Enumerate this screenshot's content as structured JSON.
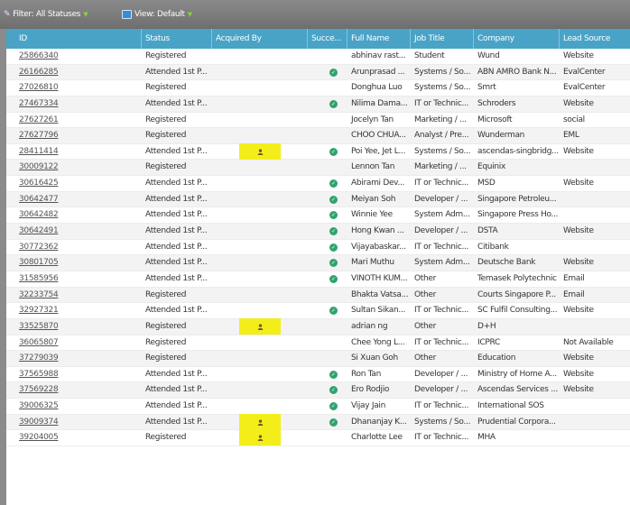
{
  "filterbar": {
    "filter_label": "Filter: All Statuses",
    "view_label": "View: Default",
    "filter_icon": "funnel-icon",
    "view_icon": "grid-view-icon",
    "caret_icon": "chevron-down-icon"
  },
  "colors": {
    "header": "#48a3c7",
    "success": "#2fa36f",
    "highlight": "#f3ee1a",
    "toolbar": "#7a7a7a"
  },
  "table": {
    "columns": [
      "ID",
      "Status",
      "Acquired By",
      "Succe...",
      "Full Name",
      "Job Title",
      "Company",
      "Lead Source"
    ],
    "rows": [
      {
        "id": "25866340",
        "status": "Registered",
        "acq": "",
        "success": false,
        "name": "abhinav rast...",
        "job": "Student",
        "company": "Wund",
        "source": "Website"
      },
      {
        "id": "26166285",
        "status": "Attended 1st P...",
        "acq": "",
        "success": true,
        "name": "Arunprasad ...",
        "job": "Systems / So...",
        "company": "ABN AMRO Bank N...",
        "source": "EvalCenter"
      },
      {
        "id": "27026810",
        "status": "Registered",
        "acq": "",
        "success": false,
        "name": "Donghua Luo",
        "job": "Systems / So...",
        "company": "Smrt",
        "source": "EvalCenter"
      },
      {
        "id": "27467334",
        "status": "Attended 1st P...",
        "acq": "",
        "success": true,
        "name": "Nilima Dama...",
        "job": "IT or Technic...",
        "company": "Schroders",
        "source": "Website"
      },
      {
        "id": "27627261",
        "status": "Registered",
        "acq": "",
        "success": false,
        "name": "Jocelyn Tan",
        "job": "Marketing / ...",
        "company": "Microsoft",
        "source": "social"
      },
      {
        "id": "27627796",
        "status": "Registered",
        "acq": "",
        "success": false,
        "name": "CHOO CHUA...",
        "job": "Analyst / Pre...",
        "company": "Wunderman",
        "source": "EML"
      },
      {
        "id": "28411414",
        "status": "Attended 1st P...",
        "acq": "person",
        "success": true,
        "name": "Poi Yee, Jet L...",
        "job": "Systems / So...",
        "company": "ascendas-singbridg...",
        "source": "Website"
      },
      {
        "id": "30009122",
        "status": "Registered",
        "acq": "",
        "success": false,
        "name": "Lennon Tan",
        "job": "Marketing / ...",
        "company": "Equinix",
        "source": ""
      },
      {
        "id": "30616425",
        "status": "Attended 1st P...",
        "acq": "",
        "success": true,
        "name": "Abirami Dev...",
        "job": "IT or Technic...",
        "company": "MSD",
        "source": "Website"
      },
      {
        "id": "30642477",
        "status": "Attended 1st P...",
        "acq": "",
        "success": true,
        "name": "Meiyan Soh",
        "job": "Developer / ...",
        "company": "Singapore Petroleu...",
        "source": ""
      },
      {
        "id": "30642482",
        "status": "Attended 1st P...",
        "acq": "",
        "success": true,
        "name": "Winnie Yee",
        "job": "System Adm...",
        "company": "Singapore Press Ho...",
        "source": ""
      },
      {
        "id": "30642491",
        "status": "Attended 1st P...",
        "acq": "",
        "success": true,
        "name": "Hong Kwan ...",
        "job": "Developer / ...",
        "company": "DSTA",
        "source": "Website"
      },
      {
        "id": "30772362",
        "status": "Attended 1st P...",
        "acq": "",
        "success": true,
        "name": "Vijayabaskar...",
        "job": "IT or Technic...",
        "company": "Citibank",
        "source": ""
      },
      {
        "id": "30801705",
        "status": "Attended 1st P...",
        "acq": "",
        "success": true,
        "name": "Mari Muthu",
        "job": "System Adm...",
        "company": "Deutsche Bank",
        "source": "Website"
      },
      {
        "id": "31585956",
        "status": "Attended 1st P...",
        "acq": "",
        "success": true,
        "name": "VINOTH KUM...",
        "job": "Other",
        "company": "Temasek Polytechnic",
        "source": "Email"
      },
      {
        "id": "32233754",
        "status": "Registered",
        "acq": "",
        "success": false,
        "name": "Bhakta Vatsa...",
        "job": "Other",
        "company": "Courts Singapore P...",
        "source": "Email"
      },
      {
        "id": "32927321",
        "status": "Attended 1st P...",
        "acq": "",
        "success": true,
        "name": "Sultan Sikan...",
        "job": "IT or Technic...",
        "company": "SC Fulfil Consulting...",
        "source": "Website"
      },
      {
        "id": "33525870",
        "status": "Registered",
        "acq": "person",
        "success": false,
        "name": "adrian ng",
        "job": "Other",
        "company": "D+H",
        "source": ""
      },
      {
        "id": "36065807",
        "status": "Registered",
        "acq": "",
        "success": false,
        "name": "Chee Yong L...",
        "job": "IT or Technic...",
        "company": "ICPRC",
        "source": "Not Available"
      },
      {
        "id": "37279039",
        "status": "Registered",
        "acq": "",
        "success": false,
        "name": "Si Xuan Goh",
        "job": "Other",
        "company": "Education",
        "source": "Website"
      },
      {
        "id": "37565988",
        "status": "Attended 1st P...",
        "acq": "",
        "success": true,
        "name": "Ron Tan",
        "job": "Developer / ...",
        "company": "Ministry of Home A...",
        "source": "Website"
      },
      {
        "id": "37569228",
        "status": "Attended 1st P...",
        "acq": "",
        "success": true,
        "name": "Ero Rodjio",
        "job": "Developer / ...",
        "company": "Ascendas Services ...",
        "source": "Website"
      },
      {
        "id": "39006325",
        "status": "Attended 1st P...",
        "acq": "",
        "success": true,
        "name": "Vijay Jain",
        "job": "IT or Technic...",
        "company": "International SOS",
        "source": ""
      },
      {
        "id": "39009374",
        "status": "Attended 1st P...",
        "acq": "person",
        "success": true,
        "name": "Dhananjay K...",
        "job": "Systems / So...",
        "company": "Prudential Corpora...",
        "source": ""
      },
      {
        "id": "39204005",
        "status": "Registered",
        "acq": "person",
        "success": false,
        "name": "Charlotte Lee",
        "job": "IT or Technic...",
        "company": "MHA",
        "source": ""
      }
    ]
  }
}
